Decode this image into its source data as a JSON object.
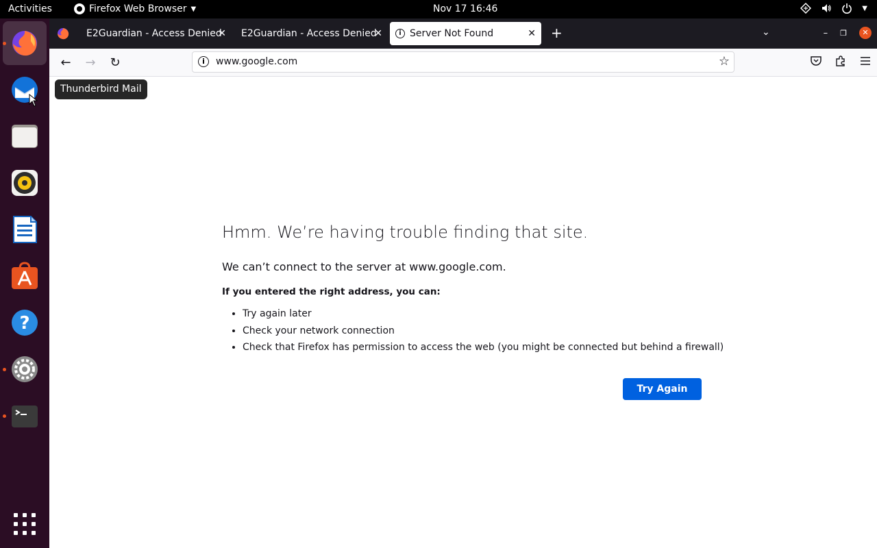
{
  "topbar": {
    "activities": "Activities",
    "app_name": "Firefox Web Browser",
    "clock": "Nov 17  16:46",
    "tray_icons": [
      "network-icon",
      "volume-icon",
      "power-icon",
      "chevron-down-icon"
    ]
  },
  "dock": {
    "items": [
      {
        "name": "Firefox",
        "icon": "firefox-icon",
        "running": true,
        "active": true
      },
      {
        "name": "Thunderbird Mail",
        "icon": "thunderbird-icon",
        "running": false,
        "hovered": true
      },
      {
        "name": "Files",
        "icon": "files-icon",
        "running": false
      },
      {
        "name": "Rhythmbox",
        "icon": "rhythmbox-icon",
        "running": false
      },
      {
        "name": "LibreOffice Writer",
        "icon": "writer-icon",
        "running": false
      },
      {
        "name": "Ubuntu Software",
        "icon": "software-icon",
        "running": false
      },
      {
        "name": "Help",
        "icon": "help-icon",
        "running": false
      },
      {
        "name": "Settings",
        "icon": "settings-icon",
        "running": true
      },
      {
        "name": "Terminal",
        "icon": "terminal-icon",
        "running": true
      }
    ],
    "show_apps_icon": "grid-icon",
    "tooltip": "Thunderbird Mail"
  },
  "tabs": [
    {
      "title": "E2Guardian - Access Denied",
      "selected": false
    },
    {
      "title": "E2Guardian - Access Denied",
      "selected": false
    },
    {
      "title": "Server Not Found",
      "selected": true
    }
  ],
  "url": {
    "text": "www.google.com"
  },
  "error": {
    "title": "Hmm. We’re having trouble finding that site.",
    "short_desc": "We can’t connect to the server at www.google.com.",
    "subheading": "If you entered the right address, you can:",
    "suggestions": [
      "Try again later",
      "Check your network connection",
      "Check that Firefox has permission to access the web (you might be connected but behind a firewall)"
    ],
    "button": "Try Again"
  },
  "colors": {
    "accent": "#0061e0",
    "ubuntu_orange": "#e95420",
    "dock_bg": "#2b0d24",
    "tabbar_bg": "#1c1b22"
  }
}
